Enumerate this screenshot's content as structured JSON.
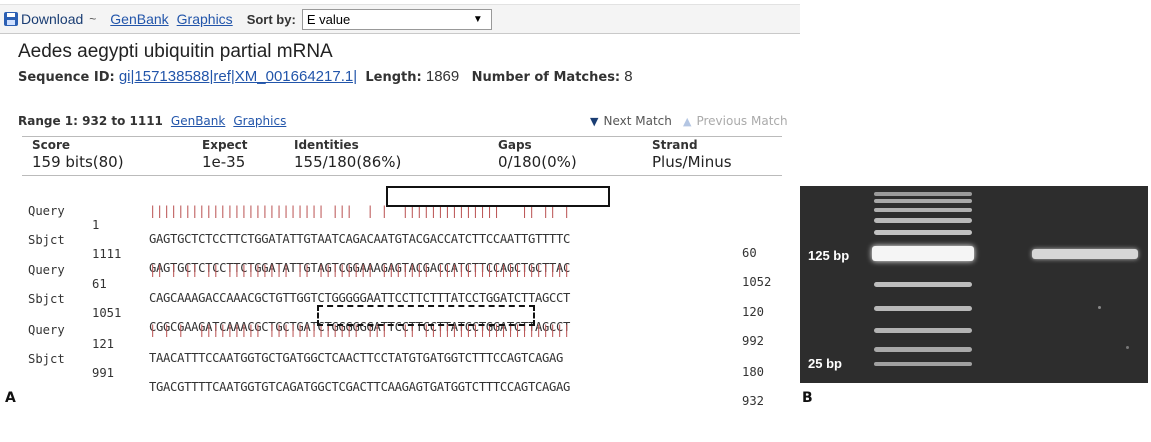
{
  "toolbar": {
    "download_label": "Download",
    "download_caret": "~",
    "genbank_link": "GenBank",
    "graphics_link": "Graphics",
    "sort_label": "Sort by:",
    "sort_value": "E value",
    "sort_arrow": "▼"
  },
  "record": {
    "title": "Aedes aegypti ubiquitin partial mRNA",
    "seq_id_label": "Sequence ID:",
    "seq_id": "gi|157138588|ref|XM_001664217.1|",
    "length_label": "Length:",
    "length": "1869",
    "matches_label": "Number of Matches:",
    "matches": "8"
  },
  "range": {
    "label": "Range 1: 932 to 1111",
    "genbank_link": "GenBank",
    "graphics_link": "Graphics",
    "next_match": "Next Match",
    "prev_match": "Previous Match"
  },
  "stats": [
    {
      "header": "Score",
      "value": "159 bits(80)"
    },
    {
      "header": "Expect",
      "value": "1e-35"
    },
    {
      "header": "Identities",
      "value": "155/180(86%)"
    },
    {
      "header": "Gaps",
      "value": "0/180(0%)"
    },
    {
      "header": "Strand",
      "value": "Plus/Minus"
    }
  ],
  "alignment": [
    {
      "query": {
        "label": "Query",
        "start": "1",
        "seq": "GAGTGCTCTCCTTCTGGATATTGTAATCAGACAATGTACGACCATCTTCCAATTGTTTTC",
        "end": "60"
      },
      "match": "||||||||||||||||||||||||| |||  | |  ||||||||||||||   || || |",
      "sbjct": {
        "label": "Sbjct",
        "start": "1111",
        "seq": "GAGTGCTCTCCTTCTGGATATTGTAGTCGGAAAGAGTACGACCATCTTCCAGCTGCTTAC",
        "end": "1052"
      }
    },
    {
      "query": {
        "label": "Query",
        "start": "61",
        "seq": "CAGCAAAGACCAAACGCTGTTGGTCTGGGGGAATTCCTTCTTTATCCTGGATCTTAGCCT",
        "end": "120"
      },
      "match": "|| | || || ||||||||| || |||||||| ||||||| |||||||||||||||||||",
      "sbjct": {
        "label": "Sbjct",
        "start": "1051",
        "seq": "CGGCGAAGATCAAACGCTGCTGATCTGGGGGGATTCCTTCCTTATCCTGGATCTTAGCCT",
        "end": "992"
      }
    },
    {
      "query": {
        "label": "Query",
        "start": "121",
        "seq": "TAACATTTCCAATGGTGCTGATGGCTCAACTTCCTATGTGATGGTCTTTCCAGTCAGAG",
        "end": "180"
      },
      "match": "| | |  ||||||||| ||||||||||||| |||  || |||||||||||||||||||||",
      "sbjct": {
        "label": "Sbjct",
        "start": "991",
        "seq": "TGACGTTTTCAATGGTGTCAGATGGCTCGACTTCAAGAGTGATGGTCTTTCCAGTCAGAG",
        "end": "932"
      }
    }
  ],
  "panel_labels": {
    "a": "A",
    "b": "B"
  },
  "gel": {
    "marker_125": "125 bp",
    "marker_25": "25 bp"
  },
  "colors": {
    "link": "#2255aa",
    "gel_background": "#2d2d2d",
    "band": "#e8e8e8"
  }
}
